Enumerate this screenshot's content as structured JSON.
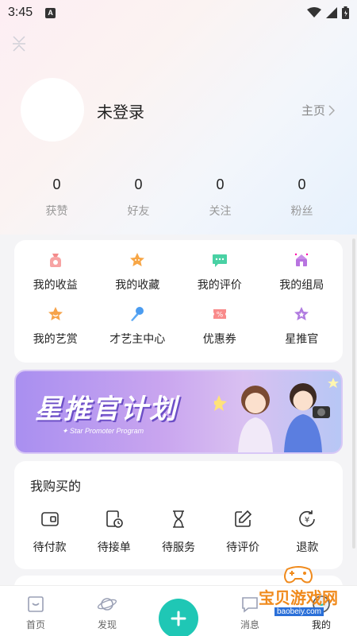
{
  "status": {
    "time": "3:45",
    "notif": "A"
  },
  "profile": {
    "login_text": "未登录",
    "home_link": "主页"
  },
  "stats": [
    {
      "value": "0",
      "label": "获赞"
    },
    {
      "value": "0",
      "label": "好友"
    },
    {
      "value": "0",
      "label": "关注"
    },
    {
      "value": "0",
      "label": "粉丝"
    }
  ],
  "menu": [
    {
      "label": "我的收益",
      "icon": "income-bag-icon"
    },
    {
      "label": "我的收藏",
      "icon": "star-favorite-icon"
    },
    {
      "label": "我的评价",
      "icon": "comment-icon"
    },
    {
      "label": "我的组局",
      "icon": "group-party-icon"
    },
    {
      "label": "我的艺赏",
      "icon": "star-reward-icon"
    },
    {
      "label": "才艺主中心",
      "icon": "microphone-icon"
    },
    {
      "label": "优惠券",
      "icon": "coupon-icon"
    },
    {
      "label": "星推官",
      "icon": "star-promoter-icon"
    }
  ],
  "banner": {
    "title": "星推官计划",
    "subtitle": "✦ Star Promoter Program"
  },
  "orders": {
    "title": "我购买的",
    "items": [
      {
        "label": "待付款",
        "icon": "wallet-icon"
      },
      {
        "label": "待接单",
        "icon": "clock-doc-icon"
      },
      {
        "label": "待服务",
        "icon": "hourglass-icon"
      },
      {
        "label": "待评价",
        "icon": "edit-icon"
      },
      {
        "label": "退款",
        "icon": "refund-yen-icon"
      }
    ]
  },
  "tabbar": [
    {
      "label": "首页",
      "icon": "home-icon"
    },
    {
      "label": "发现",
      "icon": "planet-icon"
    },
    {
      "label": "",
      "icon": "add-icon"
    },
    {
      "label": "消息",
      "icon": "message-icon"
    },
    {
      "label": "我的",
      "icon": "profile-icon"
    }
  ],
  "watermark": {
    "text": "宝贝游戏网",
    "url": "baobeiy.com"
  },
  "colors": {
    "accent": "#1fc7b5",
    "banner_start": "#a98ff0",
    "banner_end": "#b7c7f5",
    "watermark": "#f08a1c"
  }
}
